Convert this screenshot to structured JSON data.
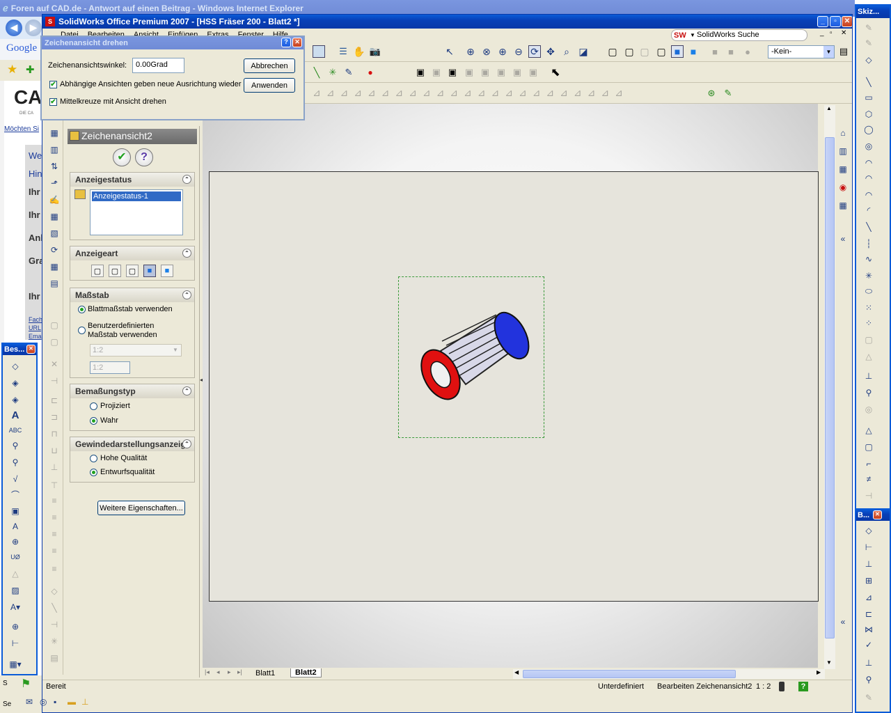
{
  "ie": {
    "title": "Foren auf CAD.de - Antwort auf einen Beitrag - Windows Internet Explorer",
    "google": "Google",
    "cad_logo": "CA",
    "cad_sub": "DIE CA",
    "moechten": "Möchten Si",
    "rows": [
      "We",
      "Hin",
      "Ihr",
      "Ihr",
      "Anl",
      "Gra",
      "Ihr"
    ],
    "links": [
      "Fach",
      "URL",
      "Ema"
    ],
    "task_start_glyph": "S",
    "bottom_left": "Se"
  },
  "sw": {
    "title": "SolidWorks Office Premium 2007 - [HSS Fräser 200 - Blatt2 *]",
    "menu": [
      "Datei",
      "Bearbeiten",
      "Ansicht",
      "Einfügen",
      "Extras",
      "Fenster",
      "Hilfe"
    ],
    "search_label": "SolidWorks Suche",
    "layer_select": "-Kein-"
  },
  "dialog": {
    "title": "Zeichenansicht drehen",
    "angle_label": "Zeichenansichtswinkel:",
    "angle_value": "0.00Grad",
    "cancel": "Abbrechen",
    "apply": "Anwenden",
    "check1": "Abhängige Ansichten geben neue Ausrichtung wieder",
    "check2": "Mittelkreuze mit Ansicht drehen"
  },
  "pm": {
    "title": "Zeichenansicht2",
    "ok_glyph": "✔",
    "help_glyph": "?",
    "sec_display_state": "Anzeigestatus",
    "display_state_item": "Anzeigestatus-1",
    "sec_display_type": "Anzeigeart",
    "sec_scale": "Maßstab",
    "scale_opt1": "Blattmaßstab verwenden",
    "scale_opt2_line1": "Benutzerdefinierten",
    "scale_opt2_line2": "Maßstab verwenden",
    "scale_select": "1:2",
    "scale_input": "1:2",
    "sec_dim_type": "Bemaßungstyp",
    "dim_opt1": "Projiziert",
    "dim_opt2": "Wahr",
    "sec_thread": "Gewindedarstellungsanzeige",
    "thread_opt1": "Hohe Qualität",
    "thread_opt2": "Entwurfsqualität",
    "more_props": "Weitere Eigenschaften..."
  },
  "tabs": [
    "Blatt1",
    "Blatt2"
  ],
  "status": {
    "ready": "Bereit",
    "underdefined": "Unterdefiniert",
    "editing": "Bearbeiten Zeichenansicht2",
    "scale": "1 : 2",
    "help": "?"
  },
  "left_tb": {
    "title": "Bes..."
  },
  "right_tb": {
    "sketch_title": "Skiz...",
    "dim_title": "B..."
  },
  "colors": {
    "xp_blue": "#0a5bd8",
    "part_red": "#e01010",
    "part_blue": "#2233dd"
  }
}
